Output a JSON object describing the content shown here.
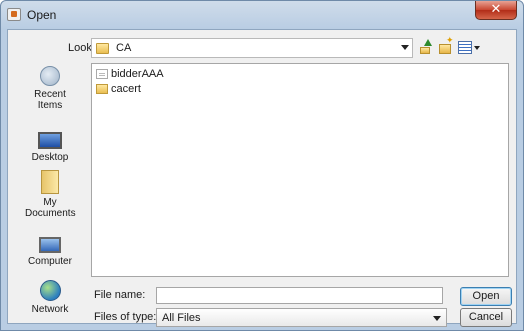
{
  "window": {
    "title": "Open",
    "close_glyph": "✕"
  },
  "toolbar": {
    "look_in_label": "Look in:",
    "look_in_value": "CA",
    "icons": [
      "up-folder-icon",
      "new-folder-icon",
      "view-menu-icon"
    ]
  },
  "places": [
    {
      "label": "Recent Items",
      "icon": "recent-items-icon"
    },
    {
      "label": "Desktop",
      "icon": "desktop-icon"
    },
    {
      "label": "My Documents",
      "icon": "my-documents-icon"
    },
    {
      "label": "Computer",
      "icon": "computer-icon"
    },
    {
      "label": "Network",
      "icon": "network-icon"
    }
  ],
  "files": [
    {
      "name": "bidderAAA",
      "icon": "document-icon"
    },
    {
      "name": "cacert",
      "icon": "folder-icon"
    }
  ],
  "footer": {
    "file_name_label": "File name:",
    "file_name_value": "",
    "files_of_type_label": "Files of type:",
    "files_of_type_value": "All Files",
    "open_label": "Open",
    "cancel_label": "Cancel"
  }
}
